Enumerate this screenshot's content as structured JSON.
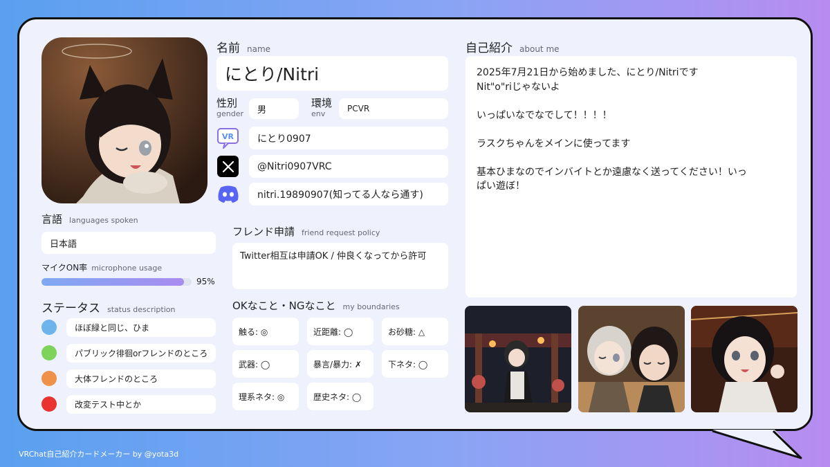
{
  "name": {
    "label": "名前",
    "sub": "name",
    "value": "にとり/Nitri"
  },
  "gender": {
    "label": "性別",
    "sub": "gender",
    "value": "男"
  },
  "env": {
    "label": "環境",
    "sub": "env",
    "value": "PCVR"
  },
  "accounts": {
    "vrchat": {
      "icon": "vrchat-icon",
      "value": "にとり0907"
    },
    "x": {
      "icon": "x-icon",
      "value": "@Nitri0907VRC"
    },
    "discord": {
      "icon": "discord-icon",
      "value": "nitri.19890907(知ってる人なら通す)"
    }
  },
  "about": {
    "label": "自己紹介",
    "sub": "about me",
    "lines": [
      "2025年7月21日から始めました、にとり/Nitriです",
      "Nit\"o\"riじゃないよ",
      "",
      "いっぱいなでなでして！！！！",
      "",
      "ラスクちゃんをメインに使ってます",
      "",
      "基本ひまなのでインバイトとか遠慮なく送ってください！いっ",
      "ぱい遊ぼ！"
    ]
  },
  "languages": {
    "label": "言語",
    "sub": "languages spoken",
    "value": "日本語"
  },
  "mic": {
    "label": "マイクON率",
    "sub": "microphone usage",
    "percent": 0.95,
    "percent_text": "95%"
  },
  "status": {
    "label": "ステータス",
    "sub": "status description",
    "items": [
      {
        "color": "#6db3ec",
        "text": "ほぼ緑と同じ、ひま"
      },
      {
        "color": "#7ed35a",
        "text": "パブリック徘徊orフレンドのところ"
      },
      {
        "color": "#f0914a",
        "text": "大体フレンドのところ"
      },
      {
        "color": "#e8332f",
        "text": "改変テスト中とか"
      }
    ]
  },
  "friend": {
    "label": "フレンド申請",
    "sub": "friend request policy",
    "value": "Twitter相互は申請OK / 仲良くなってから許可"
  },
  "boundaries": {
    "label": "OKなこと・NGなこと",
    "sub": "my boundaries",
    "items": [
      "触る: ◎",
      "近距離: ◯",
      "お砂糖: △",
      "武器: ◯",
      "暴言/暴力: ✗",
      "下ネタ: ◯",
      "理系ネタ: ◎",
      "歴史ネタ: ◯"
    ]
  },
  "footer": "VRChat自己紹介カードメーカー by @yota3d",
  "colors": {
    "accent_bar_start": "#7fa8f2",
    "accent_bar_end": "#a98cf0"
  }
}
